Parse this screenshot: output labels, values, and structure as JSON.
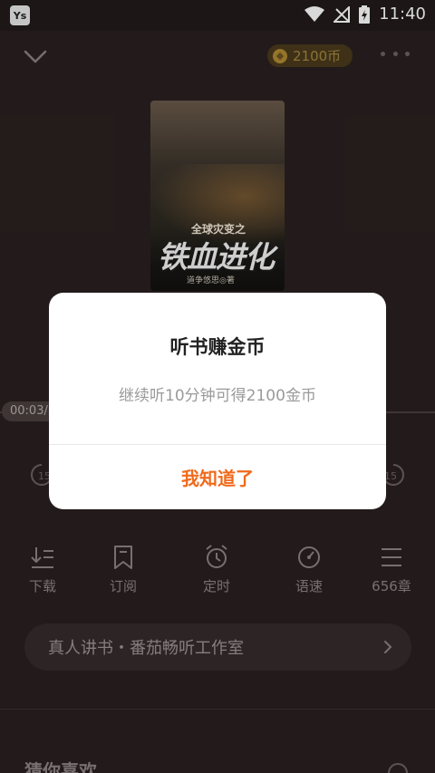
{
  "status_bar": {
    "time": "11:40",
    "app_icon_label": "Ys"
  },
  "header": {
    "coins": "2100币"
  },
  "book": {
    "cover_pretitle": "全球灾变之",
    "cover_title": "铁血进化",
    "cover_author": "道争悠思◎著"
  },
  "player": {
    "time_label": "00:03/1",
    "skip_back_label": "15",
    "skip_forward_label": "15"
  },
  "controls": [
    {
      "label": "下载",
      "icon": "download-icon"
    },
    {
      "label": "订阅",
      "icon": "bookmark-icon"
    },
    {
      "label": "定时",
      "icon": "alarm-icon"
    },
    {
      "label": "语速",
      "icon": "speed-icon"
    },
    {
      "label": "656章",
      "icon": "list-icon"
    }
  ],
  "studio": {
    "label": "真人讲书・番茄畅听工作室"
  },
  "section": {
    "guess_title": "猜你喜欢"
  },
  "dialog": {
    "title": "听书赚金币",
    "message": "继续听10分钟可得2100金币",
    "ok_label": "我知道了"
  },
  "colors": {
    "accent": "#f06a1c",
    "background": "#2a2020",
    "coin_text": "#a4883f"
  }
}
